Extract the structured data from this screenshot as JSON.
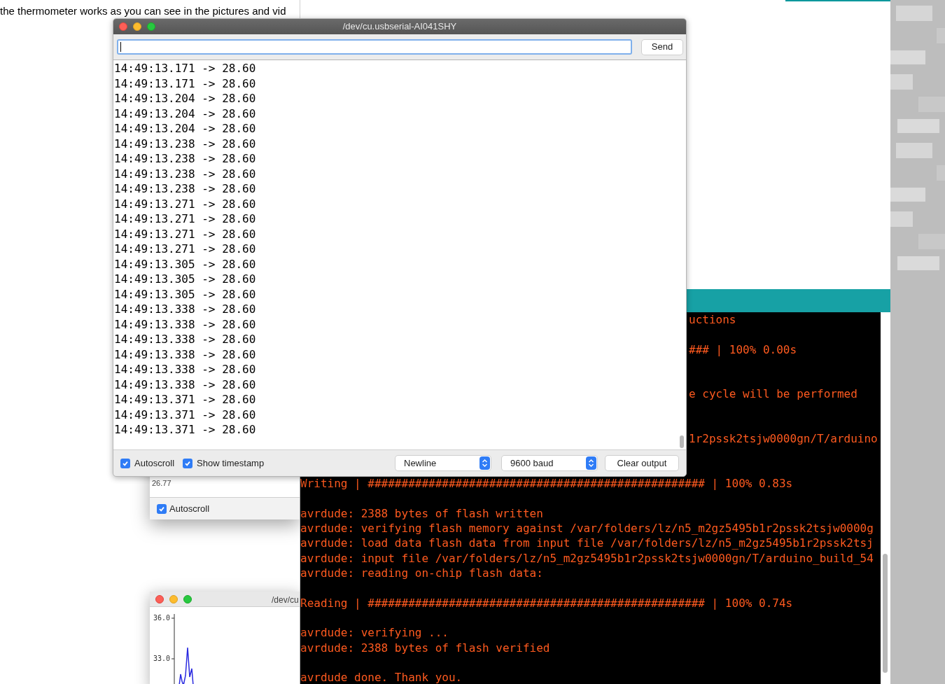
{
  "page_text": "the thermometer works as you can see in the pictures and vid",
  "console": {
    "lines": [
      {
        "kind": "clipped",
        "text": "uctions"
      },
      {
        "kind": "blank"
      },
      {
        "kind": "clipped",
        "text": "### | 100% 0.00s"
      },
      {
        "kind": "blank"
      },
      {
        "kind": "blank"
      },
      {
        "kind": "clipped",
        "text": "e cycle will be performed"
      },
      {
        "kind": "blank"
      },
      {
        "kind": "blank"
      },
      {
        "kind": "clipped",
        "text": "1r2pssk2tsjw0000gn/T/arduino"
      },
      {
        "kind": "blank"
      },
      {
        "kind": "blank"
      },
      {
        "kind": "full",
        "text": "Writing | ################################################## | 100% 0.83s"
      },
      {
        "kind": "blank"
      },
      {
        "kind": "full",
        "text": "avrdude: 2388 bytes of flash written"
      },
      {
        "kind": "full",
        "text": "avrdude: verifying flash memory against /var/folders/lz/n5_m2gz5495b1r2pssk2tsjw0000g"
      },
      {
        "kind": "full",
        "text": "avrdude: load data flash data from input file /var/folders/lz/n5_m2gz5495b1r2pssk2tsj"
      },
      {
        "kind": "full",
        "text": "avrdude: input file /var/folders/lz/n5_m2gz5495b1r2pssk2tsjw0000gn/T/arduino_build_54"
      },
      {
        "kind": "full",
        "text": "avrdude: reading on-chip flash data:"
      },
      {
        "kind": "blank"
      },
      {
        "kind": "full",
        "text": "Reading | ################################################## | 100% 0.74s"
      },
      {
        "kind": "blank"
      },
      {
        "kind": "full",
        "text": "avrdude: verifying ..."
      },
      {
        "kind": "full",
        "text": "avrdude: 2388 bytes of flash verified"
      },
      {
        "kind": "blank"
      },
      {
        "kind": "full",
        "text": "avrdude done.  Thank you."
      }
    ]
  },
  "back_monitor": {
    "value": "26.77",
    "autoscroll": {
      "label": "Autoscroll",
      "checked": true
    }
  },
  "plotter": {
    "title": "/dev/cu",
    "y_ticks": [
      "36.0",
      "33.0"
    ]
  },
  "serial_monitor": {
    "title": "/dev/cu.usbserial-AI041SHY",
    "send_button": "Send",
    "lines": [
      "14:49:13.171 -> 28.60",
      "14:49:13.171 -> 28.60",
      "14:49:13.204 -> 28.60",
      "14:49:13.204 -> 28.60",
      "14:49:13.204 -> 28.60",
      "14:49:13.238 -> 28.60",
      "14:49:13.238 -> 28.60",
      "14:49:13.238 -> 28.60",
      "14:49:13.238 -> 28.60",
      "14:49:13.271 -> 28.60",
      "14:49:13.271 -> 28.60",
      "14:49:13.271 -> 28.60",
      "14:49:13.271 -> 28.60",
      "14:49:13.305 -> 28.60",
      "14:49:13.305 -> 28.60",
      "14:49:13.305 -> 28.60",
      "14:49:13.338 -> 28.60",
      "14:49:13.338 -> 28.60",
      "14:49:13.338 -> 28.60",
      "14:49:13.338 -> 28.60",
      "14:49:13.338 -> 28.60",
      "14:49:13.338 -> 28.60",
      "14:49:13.371 -> 28.60",
      "14:49:13.371 -> 28.60",
      "14:49:13.371 -> 28.60"
    ],
    "autoscroll": {
      "label": "Autoscroll",
      "checked": true
    },
    "show_timestamp": {
      "label": "Show timestamp",
      "checked": true
    },
    "line_ending": "Newline",
    "baud": "9600 baud",
    "clear_button": "Clear output"
  }
}
